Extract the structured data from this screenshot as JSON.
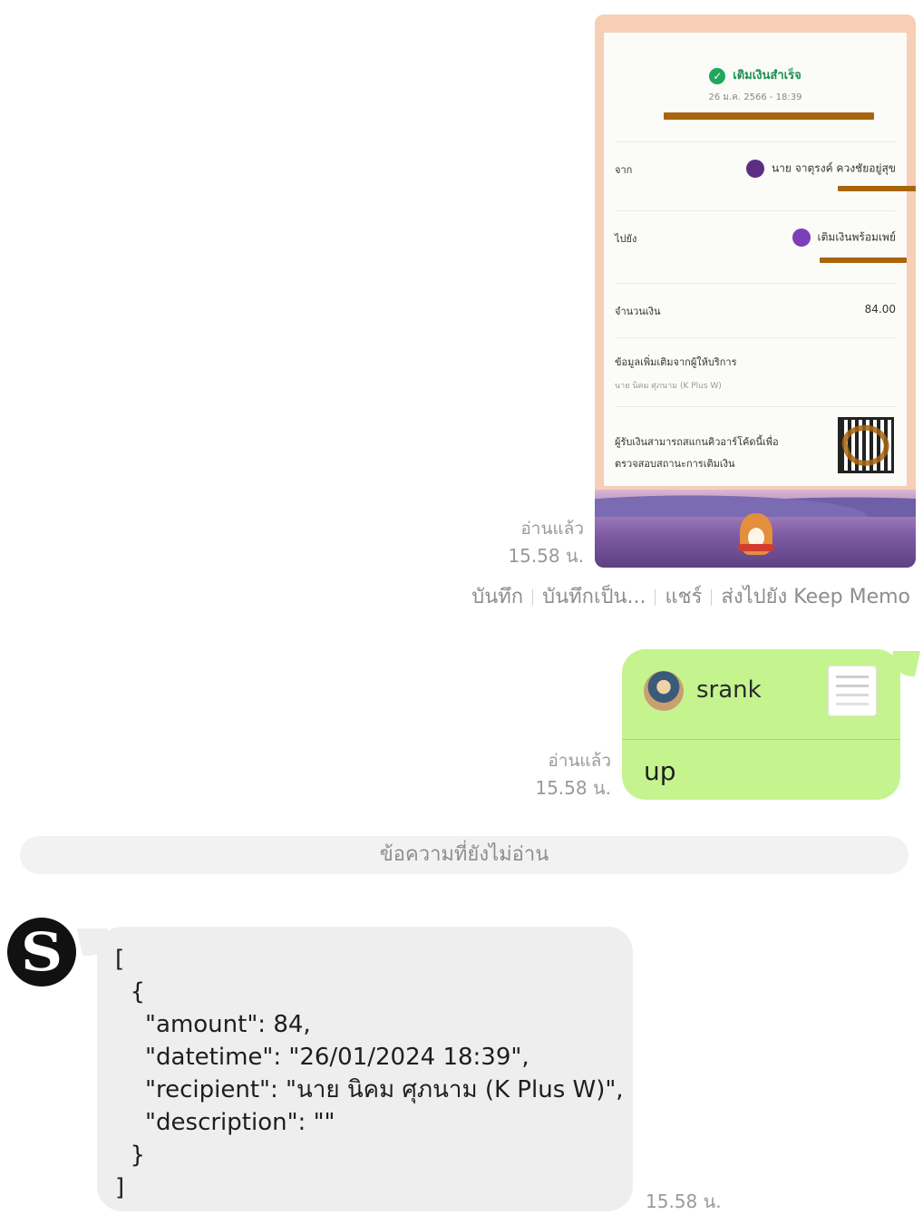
{
  "receipt": {
    "status": "เติมเงินสำเร็จ",
    "date": "26 ม.ค. 2566 - 18:39",
    "from_label": "จาก",
    "from_name": "นาย จาตุรงค์ ควงชัยอยู่สุข",
    "to_label": "ไปยัง",
    "to_name": "เติมเงินพร้อมเพย์",
    "amount_label": "จำนวนเงิน",
    "amount": "84.00",
    "extra_label": "ข้อมูลเพิ่มเติมจากผู้ให้บริการ",
    "extra_value": "นาย นิคม ศุภนาม (K Plus W)",
    "qr_note": "ผู้รับเงินสามารถสแกนคิวอาร์โค้ดนี้เพื่อตรวจสอบสถานะการเติมเงิน",
    "colors": {
      "success": "#1fa85c",
      "redaction": "#a8650f",
      "accent": "#7b3fb8"
    }
  },
  "receipt_meta": {
    "read": "อ่านแล้ว",
    "time": "15.58 น."
  },
  "actions": [
    "บันทึก",
    "บันทึกเป็น...",
    "แชร์",
    "ส่งไปยัง Keep Memo"
  ],
  "reply": {
    "quoted_name": "srank",
    "text": "up",
    "read": "อ่านแล้ว",
    "time": "15.58 น.",
    "bubble_color": "#c5f48f"
  },
  "unread_divider": "ข้อความที่ยังไม่อ่าน",
  "bot_message": {
    "avatar_letter": "S",
    "text": "[\n  {\n    \"amount\": 84,\n    \"datetime\": \"26/01/2024 18:39\",\n    \"recipient\": \"นาย นิคม ศุภนาม (K Plus W)\",\n    \"description\": \"\"\n  }\n]",
    "time": "15.58 น."
  }
}
